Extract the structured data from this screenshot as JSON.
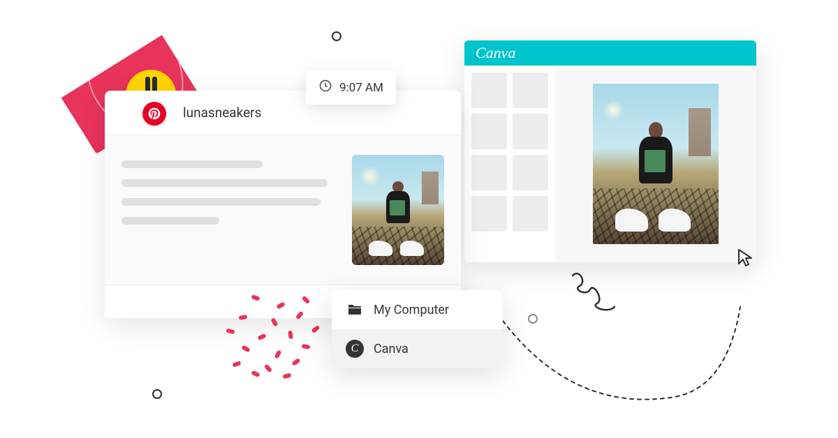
{
  "post": {
    "username": "lunasneakers",
    "platform_icon": "pinterest-icon"
  },
  "time_badge": {
    "clock_icon": "clock-icon",
    "time": "9:07 AM"
  },
  "source_menu": {
    "items": [
      {
        "icon": "folder-icon",
        "label": "My Computer",
        "selected": false
      },
      {
        "icon": "canva-icon",
        "label": "Canva",
        "selected": true
      }
    ]
  },
  "canva_window": {
    "app_name": "Canva"
  },
  "colors": {
    "canva_teal": "#00c4cc",
    "pinterest_red": "#e60023",
    "accent_pink": "#e8335a",
    "accent_yellow": "#ffd500"
  }
}
